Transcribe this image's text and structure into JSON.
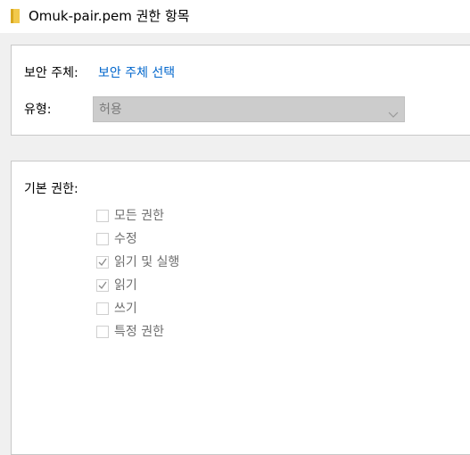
{
  "window": {
    "title": "Omuk-pair.pem 권한 항목",
    "folder_icon_color": "#f2c94c"
  },
  "principal": {
    "label": "보안 주체:",
    "select_link": "보안 주체 선택",
    "type_label": "유형:",
    "type_value": "허용",
    "type_disabled": true
  },
  "permissions": {
    "heading": "기본 권한:",
    "items": [
      {
        "label": "모든 권한",
        "checked": false
      },
      {
        "label": "수정",
        "checked": false
      },
      {
        "label": "읽기 및 실행",
        "checked": true
      },
      {
        "label": "읽기",
        "checked": true
      },
      {
        "label": "쓰기",
        "checked": false
      },
      {
        "label": "특정 권한",
        "checked": false
      }
    ]
  },
  "colors": {
    "link": "#0066cc",
    "disabled_text": "#6d6d6d"
  }
}
